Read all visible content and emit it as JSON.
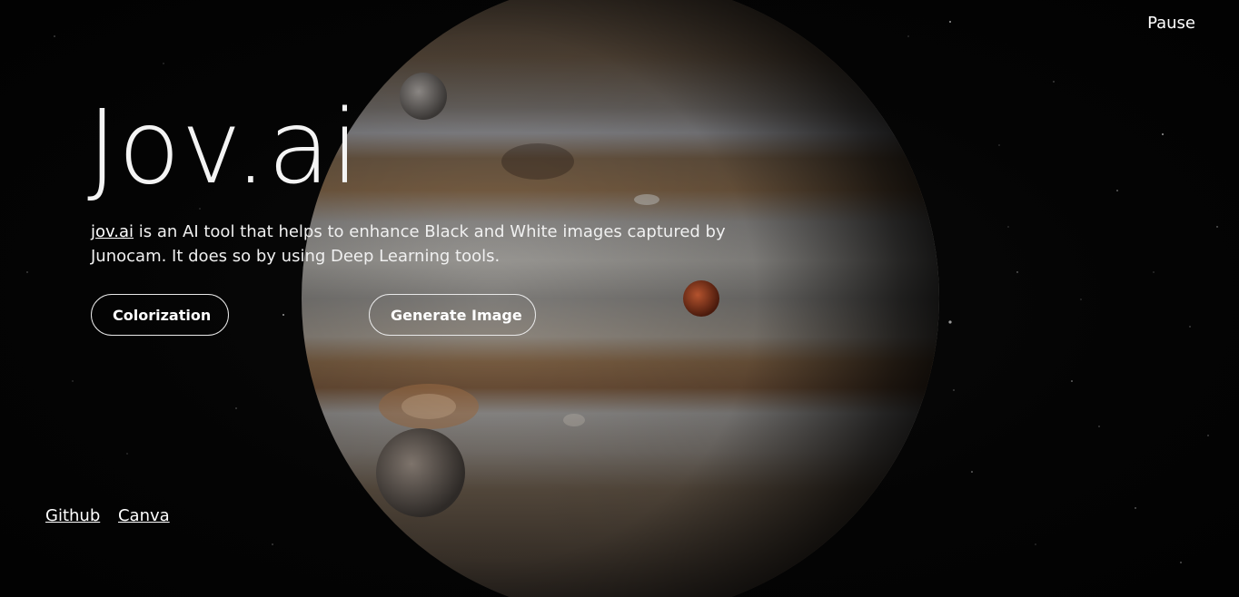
{
  "header": {
    "pause_label": "Pause"
  },
  "hero": {
    "title": "Jov.ai",
    "link_text": "jov.ai",
    "description": " is an AI tool that helps to enhance Black and White images captured by Junocam. It does so by using Deep Learning tools.",
    "buttons": {
      "colorization": "Colorization",
      "generate": "Generate Image"
    }
  },
  "footer": {
    "links": [
      "Github",
      "Canva"
    ]
  },
  "colors": {
    "background": "#030303",
    "text": "#ffffff",
    "button_border": "#e8e8e8"
  }
}
